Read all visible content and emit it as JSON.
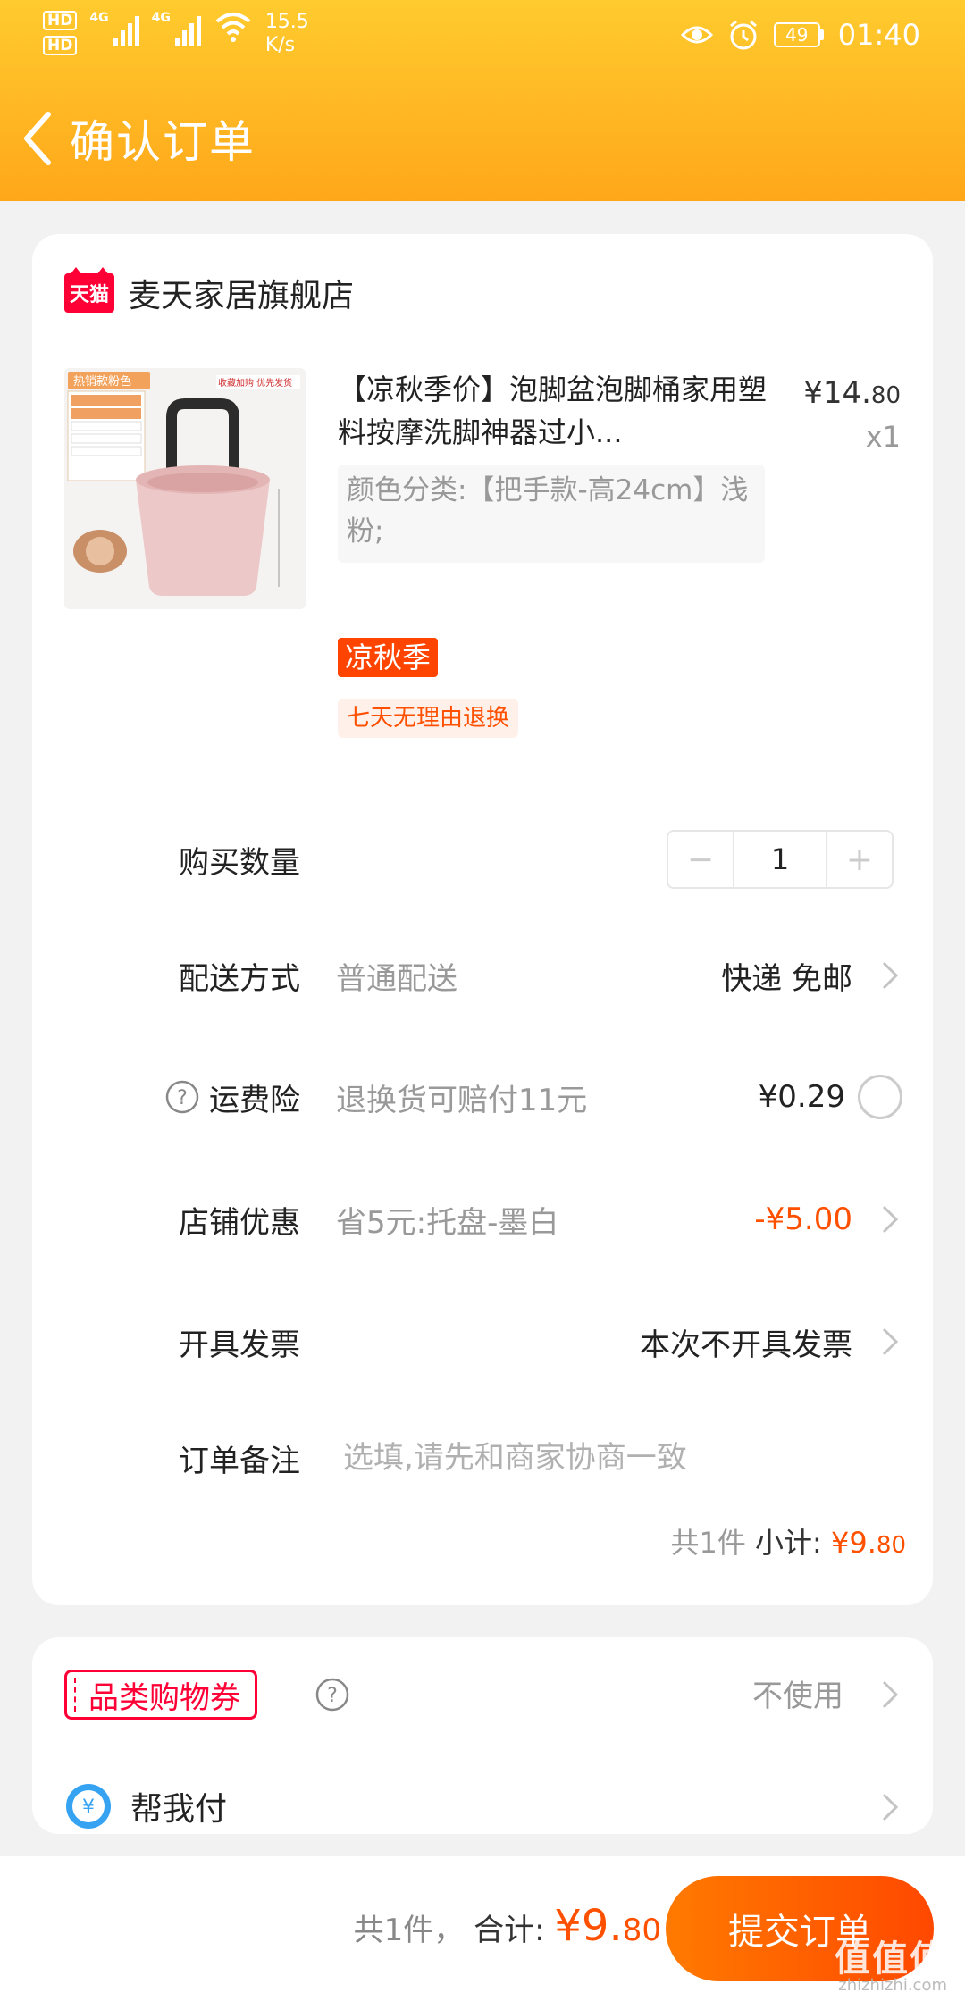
{
  "status_bar": {
    "hd1": "HD",
    "hd2": "HD",
    "net1": "4G",
    "net2": "4G",
    "speed_value": "15.5",
    "speed_unit": "K/s",
    "battery": "49",
    "time": "01:40"
  },
  "nav": {
    "title": "确认订单"
  },
  "shop": {
    "badge": "天猫",
    "name": "麦天家居旗舰店"
  },
  "product": {
    "title": "【凉秋季价】泡脚盆泡脚桶家用塑料按摩洗脚神器过小...",
    "price_main": "¥14.",
    "price_cents": "80",
    "qty": "x1",
    "sku": "颜色分类:【把手款-高24cm】浅粉;",
    "promo_tag": "凉秋季",
    "return_tag": "七天无理由退换",
    "image": {
      "top_tag": "热销款粉色",
      "side_tag": "收藏加购 优先发货",
      "bucket_color": "#ecc8c8"
    }
  },
  "rows": {
    "quantity": {
      "label": "购买数量",
      "minus": "−",
      "value": "1",
      "plus": "+"
    },
    "delivery": {
      "label": "配送方式",
      "desc": "普通配送",
      "value": "快递 免邮"
    },
    "insurance": {
      "label": "运费险",
      "desc": "退换货可赔付11元",
      "value": "¥0.29"
    },
    "shop_discount": {
      "label": "店铺优惠",
      "desc": "省5元:托盘-墨白",
      "value": "-¥5.00"
    },
    "invoice": {
      "label": "开具发票",
      "value": "本次不开具发票"
    },
    "note": {
      "label": "订单备注",
      "placeholder": "选填,请先和商家协商一致"
    }
  },
  "subtotal": {
    "count": "共1件",
    "label": "小计:",
    "amount_main": "¥9.",
    "amount_cents": "80"
  },
  "coupon": {
    "label": "品类购物券",
    "value": "不使用"
  },
  "pay_for_me": {
    "label": "帮我付"
  },
  "bottom": {
    "count": "共1件，",
    "total_label": "合计:",
    "total_main": "¥9.",
    "total_cents": "80",
    "submit": "提交订单"
  },
  "watermark": {
    "main": "值值值",
    "sub": "zhizhizhi.com"
  },
  "colors": {
    "accent": "#ff5000",
    "header_top": "#ffcb2e",
    "header_bottom": "#ffa71a",
    "tmall_red": "#ff0036"
  }
}
